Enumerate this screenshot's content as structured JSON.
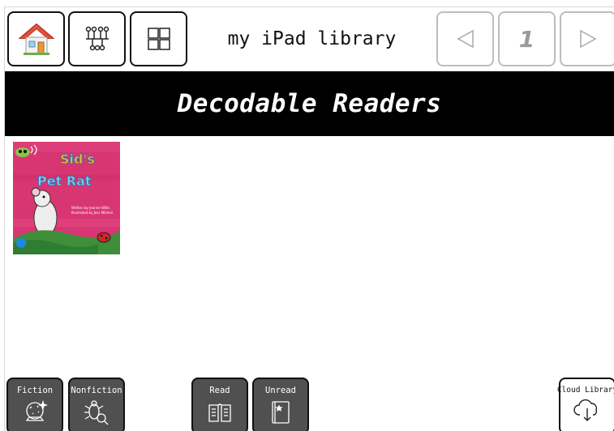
{
  "header": {
    "title": "my iPad library",
    "page_number": "1",
    "icons": [
      "home-icon",
      "switch-icon",
      "grid-icon",
      "prev-arrow-icon",
      "next-arrow-icon"
    ]
  },
  "banner": {
    "title": "Decodable Readers"
  },
  "books": [
    {
      "title_line1": "Sid's",
      "title_line2": "Pet Rat",
      "author_line": "Written by Jeanne Willis",
      "illustrator_line": "Illustrated by Jess Mikhail"
    }
  ],
  "filters": {
    "fiction_label": "Fiction",
    "nonfiction_label": "Nonfiction",
    "read_label": "Read",
    "unread_label": "Unread",
    "cloud_label": "Cloud Library"
  },
  "colors": {
    "banner_bg": "#000000",
    "filter_btn_bg": "#505050",
    "book_cover": "#d93574"
  }
}
